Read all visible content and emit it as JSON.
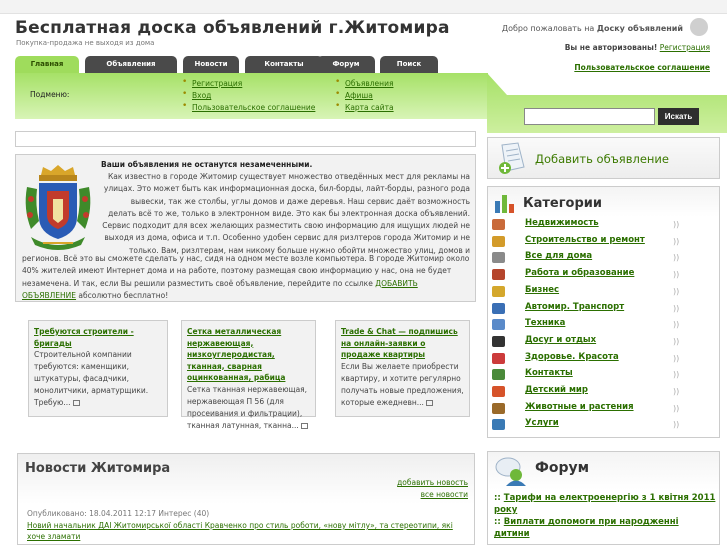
{
  "header": {
    "title": "Бесплатная доска объявлений г.Житомира",
    "subtitle": "Покупка-продажа не выходя из дома",
    "welcome_prefix": "Добро пожаловать на",
    "welcome_bold": "Доску объявлений",
    "auth_label": "Вы не авторизованы!",
    "auth_link": "Регистрация",
    "agreement_link": "Пользовательское соглашение"
  },
  "tabs": [
    {
      "label": "Главная",
      "active": true
    },
    {
      "label": "Объявления",
      "active": false
    },
    {
      "label": "Новости",
      "active": false
    },
    {
      "label": "Контакты",
      "active": false
    },
    {
      "label": "Форум",
      "active": false
    },
    {
      "label": "Поиск",
      "active": false
    }
  ],
  "submenu": {
    "label": "Подменю:",
    "col1": [
      "Регистрация",
      "Вход",
      "Пользовательское соглашение"
    ],
    "col2": [
      "Объявления",
      "Афиша",
      "Карта сайта"
    ]
  },
  "search": {
    "placeholder": "",
    "button_label": "Искать"
  },
  "intro": {
    "heading": "Ваши объявления не останутся незамеченными.",
    "text_right": "Как известно в городе Житомир существует множество отведённых мест для рекламы на улицах. Это может быть как информационная доска, бил-борды, лайт-борды, разного рода вывески, так же столбы, углы домов и даже деревья. Наш сервис даёт возможность делать всё то же, только в электронном виде. Это как бы электронная доска объявлений. Сервис подходит для всех желающих разместить свою информацию для ищущих людей не выходя из дома, офиса и т.п. Особенно удобен сервис для ризлтеров города Житомир и не только. Вам, ризлтерам, нам никому больше нужно обойти множество улиц, домов и",
    "text_bottom": "регионов. Всё это вы сможете сделать у нас, сидя на одном месте возле компьютера. В городе Житомир около 40% жителей имеют Интернет дома и на работе, поэтому размещая свою информацию у нас, она не будет незамечена. И так, если Вы решили разместить своё объявление, перейдите по ссылке",
    "link": "ДОБАВИТЬ ОБЪЯВЛЕНИЕ",
    "text_end": "абсолютно бесплатно!"
  },
  "teasers": [
    {
      "title": "Требуются строители - бригады",
      "body": "Строительной компании требуются: каменщики, штукатуры, фасадчики, монолитчики, арматурщики. Требую..."
    },
    {
      "title": "Сетка металлическая нержавеющая, низкоуглеродистая, тканная, сварная оцинкованная, рабица",
      "body": "Сетка тканная нержавеющая, нержавеющая П 56 (для просеивания и фильтрации), тканная латунная, тканна..."
    },
    {
      "title": "Trade & Chat — подпишись на онлайн-заявки о продаже квартиры",
      "body": "Если Вы желаете приобрести квартиру, и хотите регулярно получать новые предложения, которые ежедневн..."
    }
  ],
  "news": {
    "title": "Новости Житомира",
    "add_link": "добавить новость",
    "all_link": "все новости",
    "meta": "Опубликовано: 18.04.2011 12:17 Интерес (40)",
    "item": "Новий начальник ДАІ Житомирської області Кравченко про стиль роботи, «нову мітлу», та стереотипи, які хоче зламати"
  },
  "add_ad": {
    "label": "Добавить объявление"
  },
  "categories": {
    "title": "Категории",
    "items": [
      {
        "label": "Недвижимость",
        "icon": "house-icon",
        "color": "#c96a3a"
      },
      {
        "label": "Строительство и ремонт",
        "icon": "tools-icon",
        "color": "#d39b2a"
      },
      {
        "label": "Все для дома",
        "icon": "home-goods-icon",
        "color": "#8a8a8a"
      },
      {
        "label": "Работа и образование",
        "icon": "briefcase-icon",
        "color": "#b5452c"
      },
      {
        "label": "Бизнес",
        "icon": "money-icon",
        "color": "#d4a72c"
      },
      {
        "label": "Автомир. Транспорт",
        "icon": "car-icon",
        "color": "#3a6fb5"
      },
      {
        "label": "Техника",
        "icon": "monitor-icon",
        "color": "#5a8ac9"
      },
      {
        "label": "Досуг и отдых",
        "icon": "ball-icon",
        "color": "#333333"
      },
      {
        "label": "Здоровье. Красота",
        "icon": "heart-icon",
        "color": "#cc3b3b"
      },
      {
        "label": "Контакты",
        "icon": "people-icon",
        "color": "#4a8a3a"
      },
      {
        "label": "Детский мир",
        "icon": "toy-icon",
        "color": "#d6532a"
      },
      {
        "label": "Животные и растения",
        "icon": "paw-icon",
        "color": "#9a6a2a"
      },
      {
        "label": "Услуги",
        "icon": "magnifier-icon",
        "color": "#3a7ab5"
      }
    ]
  },
  "forum": {
    "title": "Форум",
    "items": [
      "Тарифи на електроенергію з 1 квітня 2011 року",
      "Виплати допомоги при народженні дитини"
    ]
  },
  "colors": {
    "accent": "#a6e167",
    "link": "#2b6f00",
    "tab_dark": "#4a4a4a"
  }
}
